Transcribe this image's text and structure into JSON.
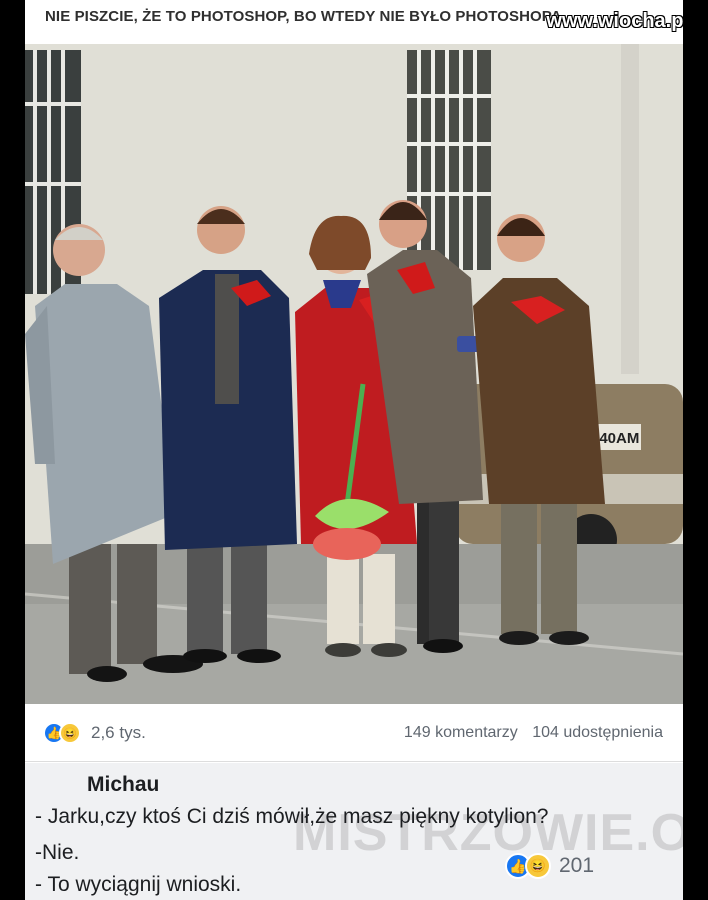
{
  "caption": "NIE PISZCIE, ŻE TO PHOTOSHOP, BO WTEDY NIE BYŁO PHOTOSHOPA",
  "site": "www.wiocha.pl",
  "photo": {
    "plate": "2040AM"
  },
  "post": {
    "reaction_count": "2,6 tys.",
    "comments": "149 komentarzy",
    "shares": "104 udostępnienia",
    "icons": [
      "like-icon",
      "haha-icon"
    ]
  },
  "comment": {
    "author": "Michau",
    "lines": [
      "- Jarku,czy ktoś Ci dziś mówił,że masz piękny kotylion?",
      "-Nie.",
      "- To wyciągnij wnioski."
    ],
    "reaction_count": "201"
  },
  "watermark": "MISTRZOWIE.ORG",
  "colors": {
    "like": "#1877f2",
    "haha": "#f7c83a",
    "text": "#1c1e21",
    "muted": "#606770"
  }
}
